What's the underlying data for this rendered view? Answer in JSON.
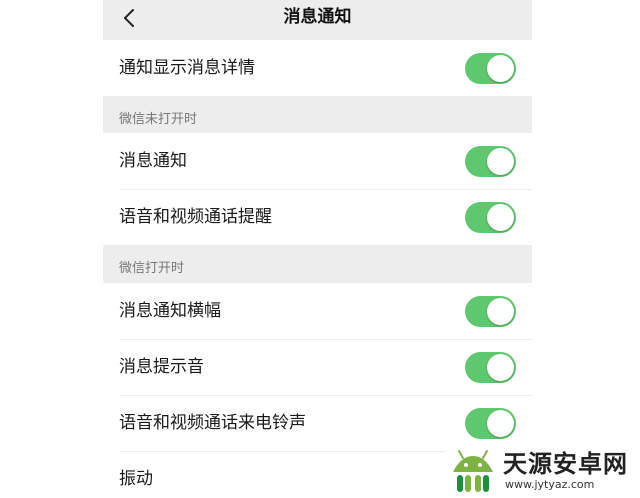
{
  "header": {
    "title": "消息通知",
    "back_icon": "chevron-left-icon"
  },
  "top_group": {
    "items": [
      {
        "label": "通知显示消息详情",
        "on": true
      }
    ]
  },
  "section_closed": {
    "header": "微信未打开时",
    "items": [
      {
        "label": "消息通知",
        "on": true
      },
      {
        "label": "语音和视频通话提醒",
        "on": true
      }
    ]
  },
  "section_open": {
    "header": "微信打开时",
    "items": [
      {
        "label": "消息通知横幅",
        "on": true
      },
      {
        "label": "消息提示音",
        "on": true
      },
      {
        "label": "语音和视频通话来电铃声",
        "on": true
      },
      {
        "label": "振动"
      }
    ]
  },
  "watermark": {
    "name": "天源安卓网",
    "url": "www.jytyaz.com"
  },
  "colors": {
    "toggle_on": "#5ec86e",
    "page_bg": "#ededed"
  }
}
